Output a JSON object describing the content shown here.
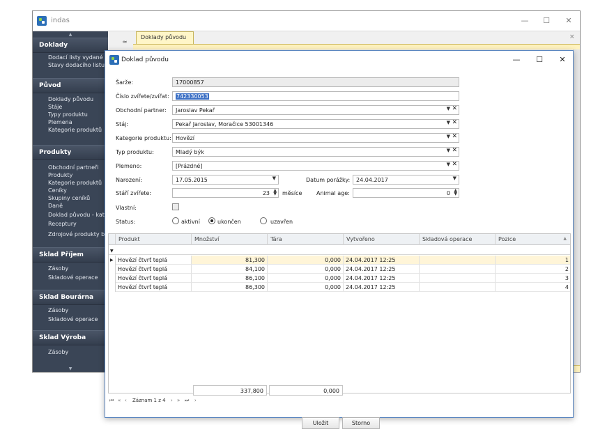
{
  "app": {
    "title": "indas"
  },
  "window_controls": {
    "minimize": "—",
    "maximize": "☐",
    "close": "✕"
  },
  "sidebar": {
    "groups": [
      {
        "title": "Doklady",
        "items": [
          "Dodací listy vydané",
          "Stavy dodacího listu"
        ]
      },
      {
        "title": "Původ",
        "items": [
          "Doklady původu",
          "Stáje",
          "Typy produktu",
          "Plemena",
          "Kategorie produktů"
        ]
      },
      {
        "title": "Produkty",
        "items": [
          "Obchodní partneři",
          "Produkty",
          "Kategorie produktů",
          "Ceníky",
          "Skupiny ceníků",
          "Daně",
          "Doklad původu - katego",
          "Receptury",
          "Zdrojové produkty bou"
        ]
      },
      {
        "title": "Sklad Příjem",
        "items": [
          "Zásoby",
          "Skladové operace"
        ]
      },
      {
        "title": "Sklad Bourárna",
        "items": [
          "Zásoby",
          "Skladové operace"
        ]
      },
      {
        "title": "Sklad Výroba",
        "items": [
          "Zásoby"
        ]
      }
    ]
  },
  "outer_tab": {
    "label": "Doklady původu",
    "close": "×"
  },
  "dialog": {
    "title": "Doklad původu",
    "fields": {
      "sarze": {
        "label": "Šarže:",
        "value": "17000857"
      },
      "cislo_zvirete": {
        "label": "Číslo zvířete/zvířat:",
        "value": "742330053"
      },
      "obchodni_partner": {
        "label": "Obchodní partner:",
        "value": "Jaroslav Pekař"
      },
      "staj": {
        "label": "Stáj:",
        "value": "Pekař Jaroslav, Moračice 53001346"
      },
      "kategorie_produktu": {
        "label": "Kategorie produktu:",
        "value": "Hovězí"
      },
      "typ_produktu": {
        "label": "Typ produktu:",
        "value": "Mladý býk"
      },
      "plemeno": {
        "label": "Plemeno:",
        "value": "[Prázdné]"
      },
      "narozeni": {
        "label": "Narození:",
        "value": "17.05.2015"
      },
      "datum_porazky": {
        "label": "Datum porážky:",
        "value": "24.04.2017"
      },
      "stari_zvirete": {
        "label": "Stáří zvířete:",
        "value": "23",
        "unit": "měsíce"
      },
      "animal_age": {
        "label": "Animal age:",
        "value": "0"
      },
      "vlastni": {
        "label": "Vlastní:"
      },
      "status": {
        "label": "Status:",
        "options": [
          "aktivní",
          "ukončen",
          "uzavřen"
        ],
        "selected": "ukončen"
      }
    },
    "grid": {
      "columns": [
        "Produkt",
        "Množství",
        "Tára",
        "Vytvořeno",
        "Skladová operace",
        "Pozice"
      ],
      "rows": [
        {
          "produkt": "Hovězí čtvrť teplá",
          "mnozstvi": "81,300",
          "tara": "0,000",
          "vytvoreno": "24.04.2017 12:25",
          "skladova_operace": "",
          "pozice": "1"
        },
        {
          "produkt": "Hovězí čtvrť teplá",
          "mnozstvi": "84,100",
          "tara": "0,000",
          "vytvoreno": "24.04.2017 12:25",
          "skladova_operace": "",
          "pozice": "2"
        },
        {
          "produkt": "Hovězí čtvrť teplá",
          "mnozstvi": "86,100",
          "tara": "0,000",
          "vytvoreno": "24.04.2017 12:25",
          "skladova_operace": "",
          "pozice": "3"
        },
        {
          "produkt": "Hovězí čtvrť teplá",
          "mnozstvi": "86,300",
          "tara": "0,000",
          "vytvoreno": "24.04.2017 12:25",
          "skladova_operace": "",
          "pozice": "4"
        }
      ],
      "totals": {
        "mnozstvi": "337,800",
        "tara": "0,000"
      }
    },
    "navigator": {
      "record_text": "Záznam 1 z 4"
    },
    "buttons": {
      "save": "Uložit",
      "cancel": "Storno"
    }
  }
}
